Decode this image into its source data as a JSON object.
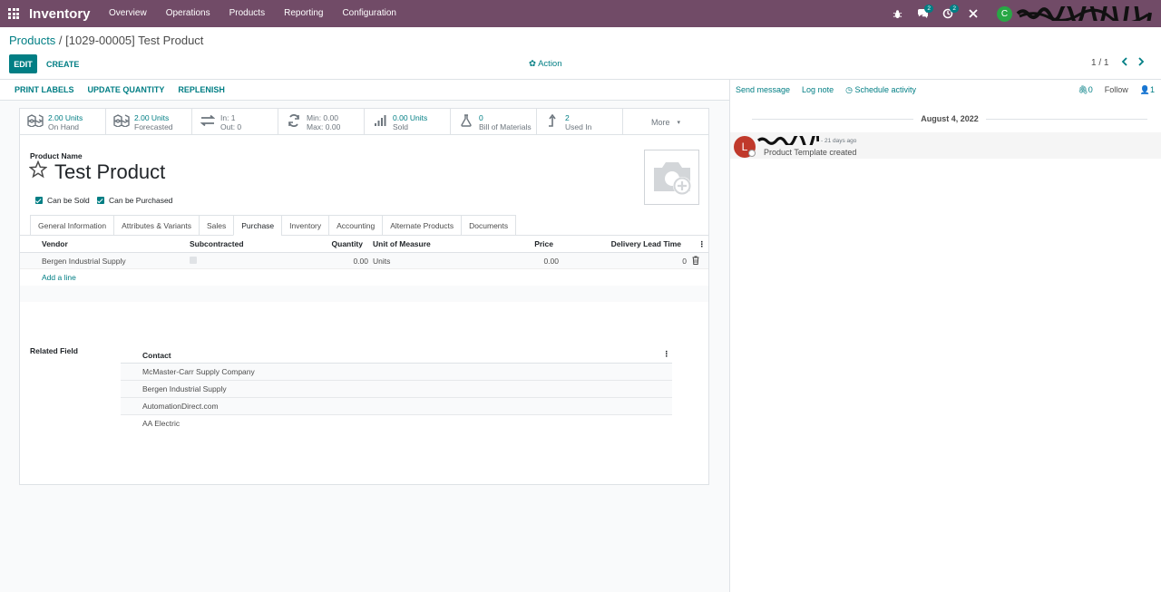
{
  "navbar": {
    "app_title": "Inventory",
    "menu": [
      "Overview",
      "Operations",
      "Products",
      "Reporting",
      "Configuration"
    ],
    "messages_badge": "2",
    "activities_badge": "2",
    "user_initial": "C"
  },
  "control_panel": {
    "breadcrumb_parent": "Products",
    "breadcrumb_separator": " / ",
    "breadcrumb_current": "[1029-00005] Test Product",
    "edit_label": "EDIT",
    "create_label": "CREATE",
    "action_label": "Action",
    "pager_value": "1 / 1"
  },
  "statusbar": {
    "buttons": [
      "PRINT LABELS",
      "UPDATE QUANTITY",
      "REPLENISH"
    ]
  },
  "smart_buttons": [
    {
      "icon": "cubes-icon",
      "line1": "2.00 Units",
      "line2": "On Hand"
    },
    {
      "icon": "cubes-icon",
      "line1": "2.00 Units",
      "line2": "Forecasted"
    },
    {
      "icon": "exchange-icon",
      "line1": "In:   1",
      "line2": "Out:  0"
    },
    {
      "icon": "refresh-icon",
      "line1": "Min:  0.00",
      "line2": "Max:  0.00"
    },
    {
      "icon": "signal-icon",
      "line1": "0.00 Units",
      "line2": "Sold"
    },
    {
      "icon": "flask-icon",
      "line1": "0",
      "line2": "Bill of Materials"
    },
    {
      "icon": "level-up-icon",
      "line1": "2",
      "line2": "Used In"
    }
  ],
  "more_label": "More",
  "product": {
    "name_label": "Product Name",
    "name": "Test Product",
    "can_be_sold_label": "Can be Sold",
    "can_be_purchased_label": "Can be Purchased"
  },
  "tabs": [
    "General Information",
    "Attributes & Variants",
    "Sales",
    "Purchase",
    "Inventory",
    "Accounting",
    "Alternate Products",
    "Documents"
  ],
  "active_tab": "Purchase",
  "vendor_table": {
    "headers": {
      "vendor": "Vendor",
      "subcontracted": "Subcontracted",
      "quantity": "Quantity",
      "uom": "Unit of Measure",
      "price": "Price",
      "lead_time": "Delivery Lead Time"
    },
    "rows": [
      {
        "vendor": "Bergen Industrial Supply",
        "quantity": "0.00",
        "uom": "Units",
        "price": "0.00",
        "lead_time": "0"
      }
    ],
    "add_line": "Add a line"
  },
  "related": {
    "label": "Related Field",
    "header": "Contact",
    "rows": [
      "McMaster-Carr Supply Company",
      "Bergen Industrial Supply",
      "AutomationDirect.com",
      "AA Electric"
    ]
  },
  "chatter": {
    "send_message": "Send message",
    "log_note": "Log note",
    "schedule_activity": "Schedule activity",
    "attachments_count": "0",
    "follow_label": "Follow",
    "followers_count": "1",
    "date": "August 4, 2022",
    "message": {
      "avatar_initial": "L",
      "time": "- 21 days ago",
      "body": "Product Template created"
    }
  }
}
